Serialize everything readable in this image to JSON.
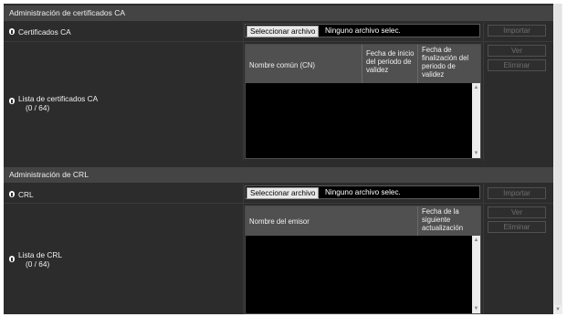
{
  "ca_section": {
    "title": "Administración de certificados CA",
    "certs_label": "Certificados CA",
    "file_button": "Seleccionar archivo",
    "file_status": "Ninguno archivo selec.",
    "import_button": "Importar",
    "list_label": "Lista de certificados CA",
    "list_count": "(0 / 64)",
    "columns": [
      "Nombre común (CN)",
      "Fecha de inicio del periodo de validez",
      "Fecha de finalización del periodo de validez"
    ],
    "view_button": "Ver",
    "delete_button": "Eliminar"
  },
  "crl_section": {
    "title": "Administración de CRL",
    "crl_label": "CRL",
    "file_button": "Seleccionar archivo",
    "file_status": "Ninguno archivo selec.",
    "import_button": "Importar",
    "list_label": "Lista de CRL",
    "list_count": "(0 / 64)",
    "columns": [
      "Nombre del emisor",
      "Fecha de la siguiente actualización"
    ],
    "view_button": "Ver",
    "delete_button": "Eliminar"
  }
}
